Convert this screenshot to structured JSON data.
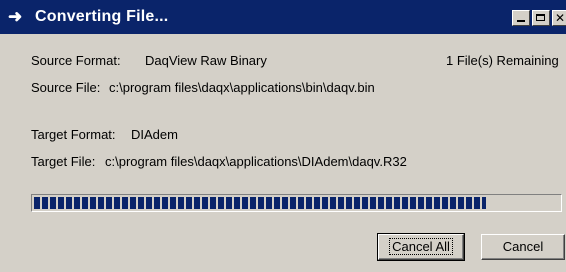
{
  "window": {
    "title": "Converting File...",
    "title_icon": "arrow-right-icon",
    "controls": {
      "minimize_icon": "minimize-icon",
      "maximize_icon": "maximize-icon",
      "close_icon": "close-icon"
    }
  },
  "source": {
    "format_label": "Source Format:",
    "format_value": "DaqView Raw Binary",
    "remaining": "1 File(s) Remaining",
    "file_label": "Source File:",
    "file_value": "c:\\program files\\daqx\\applications\\bin\\daqv.bin"
  },
  "target": {
    "format_label": "Target Format:",
    "format_value": "DIAdem",
    "file_label": "Target File:",
    "file_value": "c:\\program files\\daqx\\applications\\DIAdem\\daqv.R32"
  },
  "progress": {
    "fraction": 0.86
  },
  "buttons": {
    "cancel_all": "Cancel All",
    "cancel": "Cancel"
  },
  "colors": {
    "titlebar": "#0a246a",
    "face": "#d4d0c8",
    "progress": "#0a246a"
  }
}
